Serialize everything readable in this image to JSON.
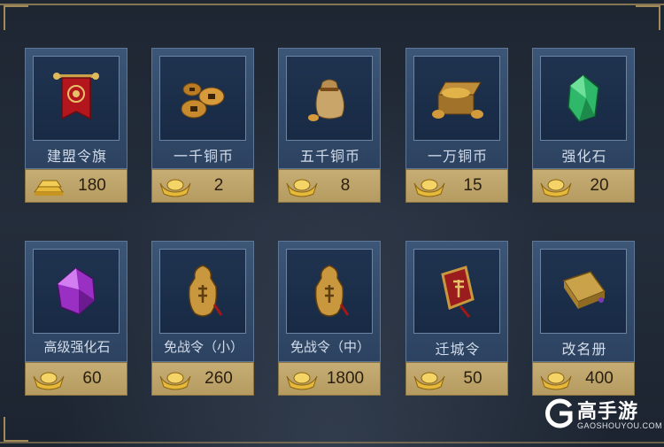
{
  "items": [
    {
      "name": "建盟令旗",
      "price": "180",
      "icon": "alliance-banner-icon",
      "currency": "gold-bars-icon"
    },
    {
      "name": "一千铜币",
      "price": "2",
      "icon": "copper-coins-icon",
      "currency": "gold-ingot-icon"
    },
    {
      "name": "五千铜币",
      "price": "8",
      "icon": "coin-bag-icon",
      "currency": "gold-ingot-icon"
    },
    {
      "name": "一万铜币",
      "price": "15",
      "icon": "treasure-chest-icon",
      "currency": "gold-ingot-icon"
    },
    {
      "name": "强化石",
      "price": "20",
      "icon": "green-gem-icon",
      "currency": "gold-ingot-icon"
    },
    {
      "name": "高级强化石",
      "price": "60",
      "icon": "purple-gem-icon",
      "currency": "gold-ingot-icon"
    },
    {
      "name": "免战令（小）",
      "price": "260",
      "icon": "truce-token-small-icon",
      "currency": "gold-ingot-icon"
    },
    {
      "name": "免战令（中）",
      "price": "1800",
      "icon": "truce-token-medium-icon",
      "currency": "gold-ingot-icon"
    },
    {
      "name": "迁城令",
      "price": "50",
      "icon": "relocation-token-icon",
      "currency": "gold-ingot-icon"
    },
    {
      "name": "改名册",
      "price": "400",
      "icon": "rename-book-icon",
      "currency": "gold-ingot-icon"
    }
  ],
  "watermark": {
    "name": "高手游",
    "sub": "GAOSHOUYOU.COM"
  },
  "colors": {
    "card_blue": "#2c4260",
    "price_gold": "#c6ad74",
    "text_light": "#d3dcea"
  }
}
